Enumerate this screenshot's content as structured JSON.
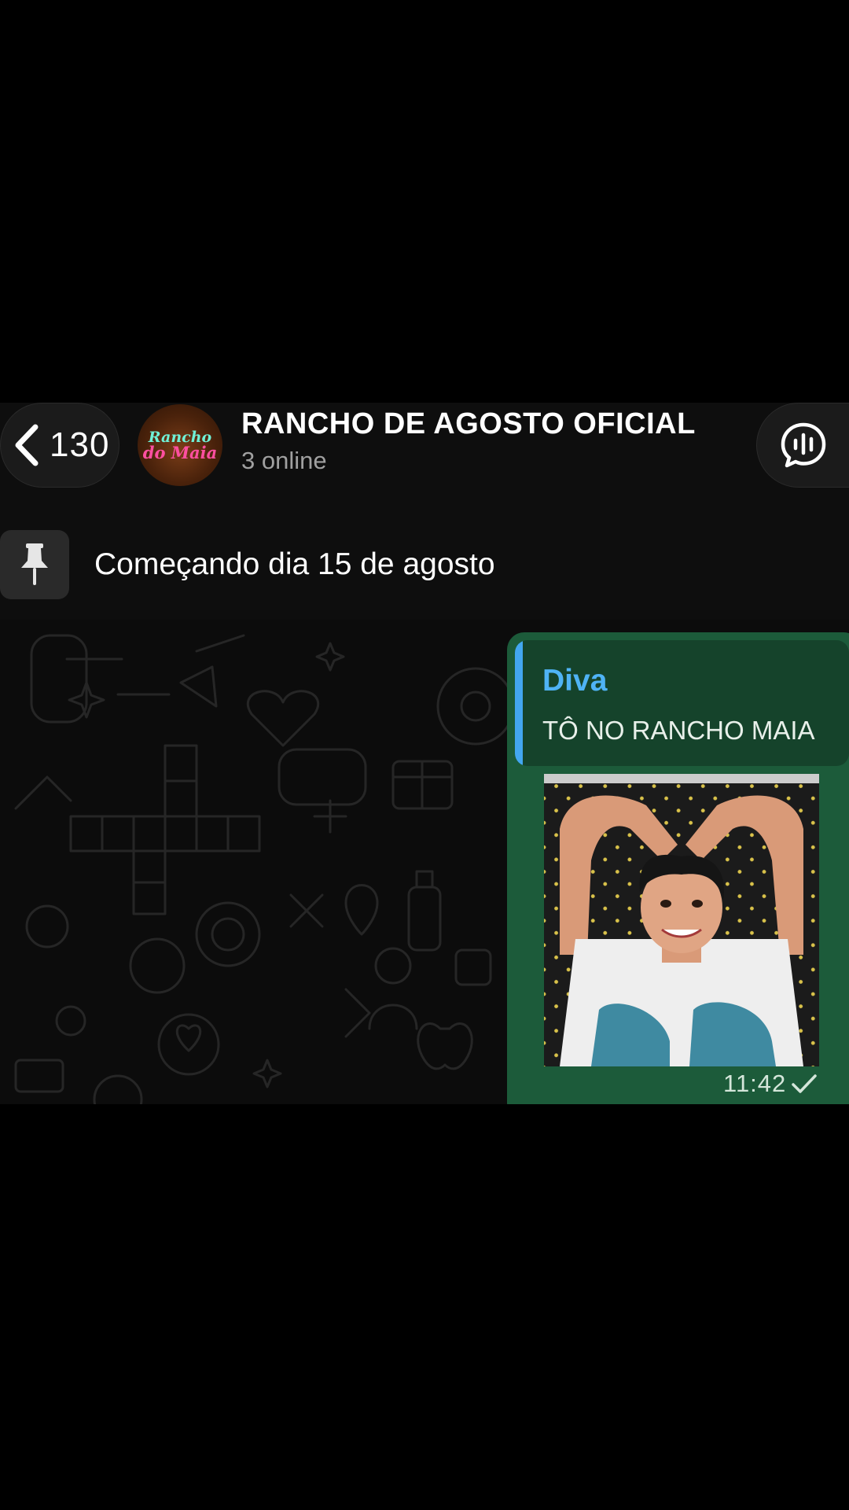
{
  "header": {
    "back_count": "130",
    "avatar_text_line1": "Rancho",
    "avatar_text_line2": "do Maia",
    "title": "RANCHO DE AGOSTO OFICIAL",
    "status": "3 online"
  },
  "pinned": {
    "text": "Começando dia 15 de agosto"
  },
  "message": {
    "reply_author": "Diva",
    "reply_text": "TÔ NO RANCHO MAIA",
    "time": "11:42",
    "status_icon": "check-icon"
  },
  "colors": {
    "background": "#000000",
    "header_bg": "#0e0e0e",
    "bubble_bg": "#1c5b3a",
    "reply_bg": "#15432b",
    "reply_accent": "#43a7f0",
    "reply_author": "#4fb3f5"
  }
}
